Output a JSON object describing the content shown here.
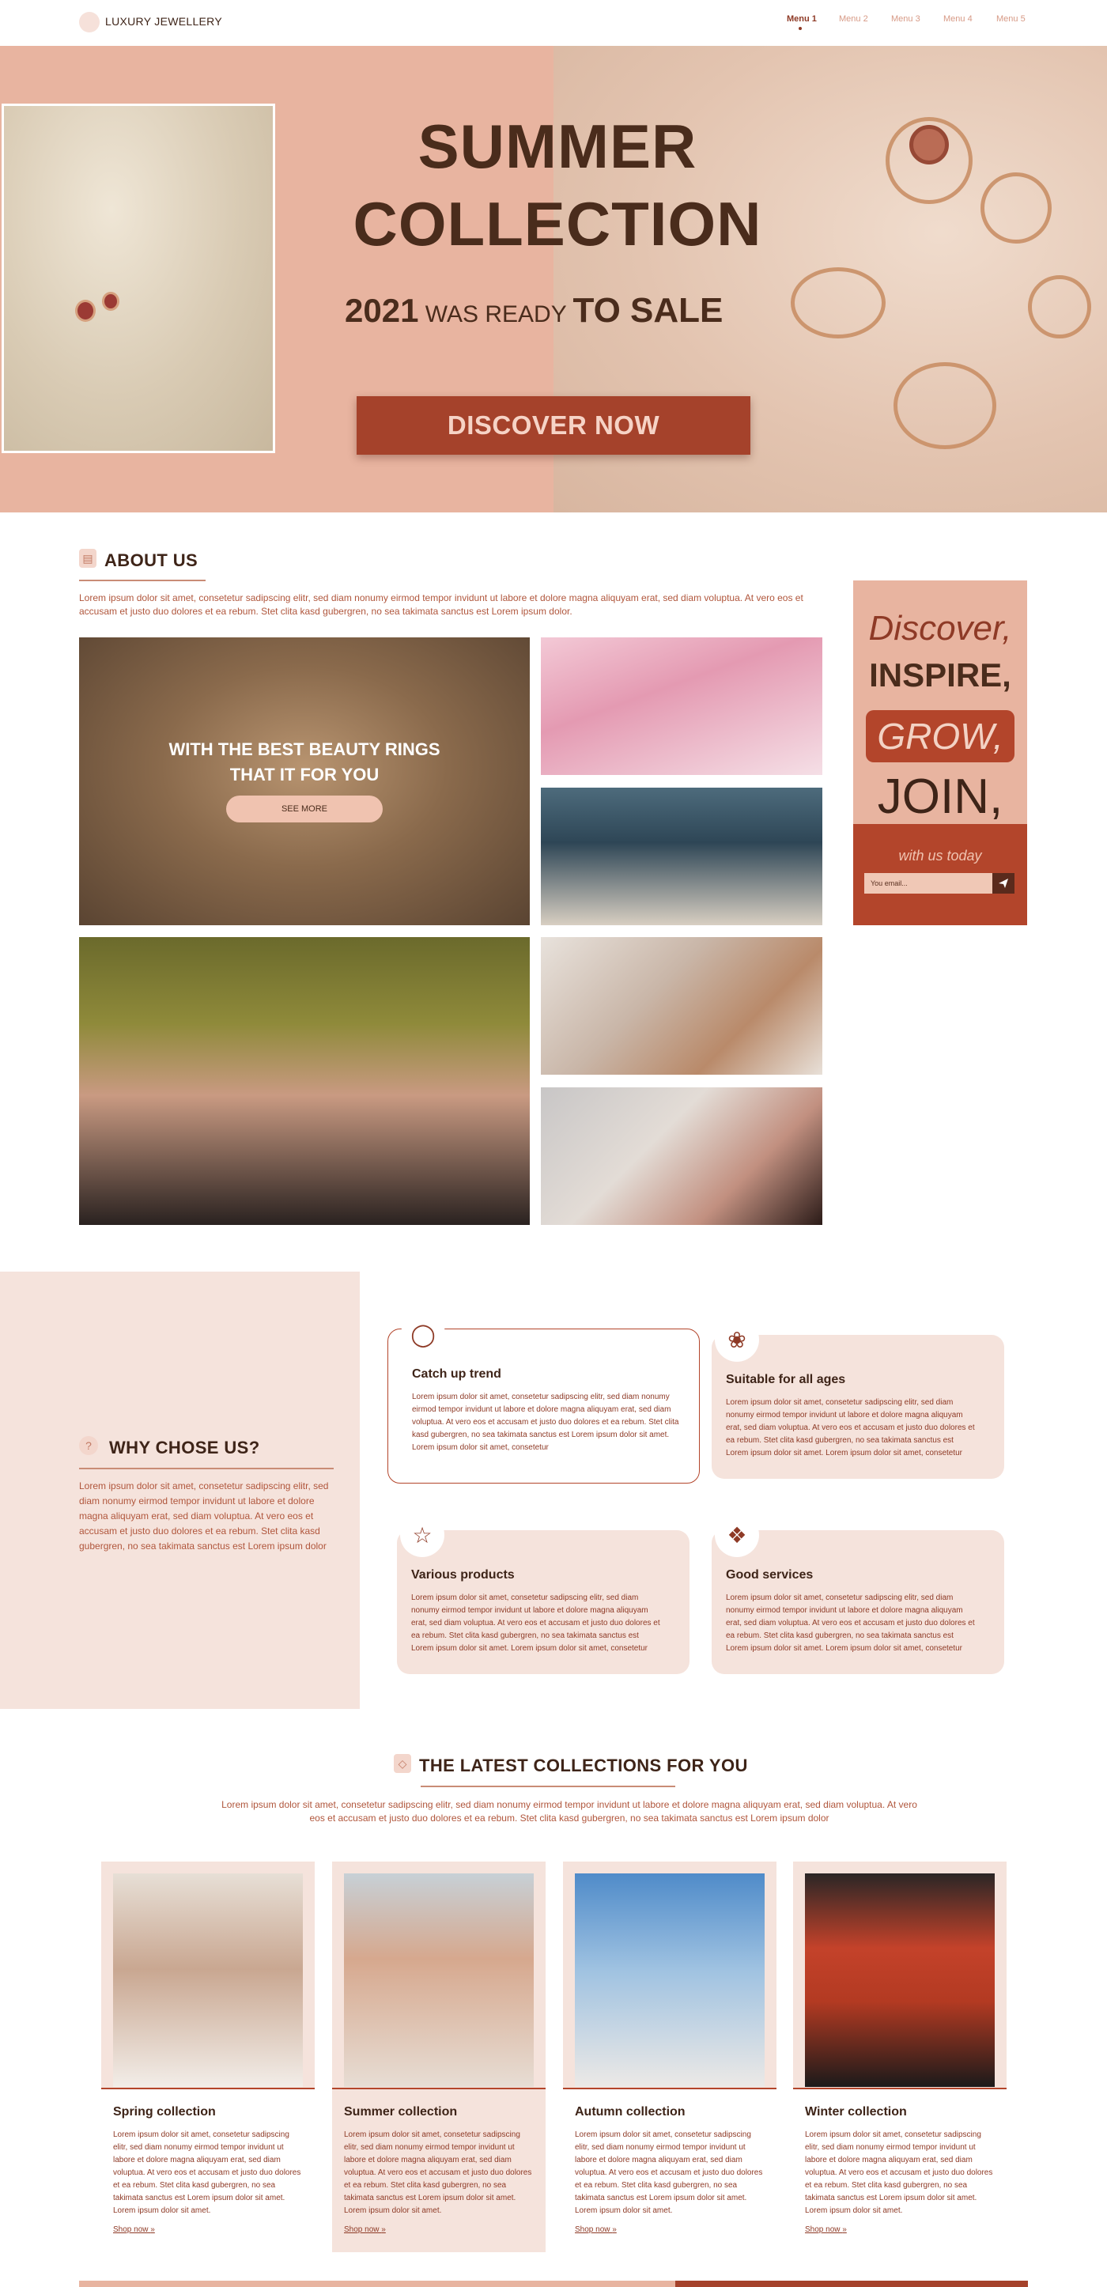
{
  "header": {
    "logo_text": "LUXURY JEWELLERY",
    "nav": [
      "Menu 1",
      "Menu 2",
      "Menu 3",
      "Menu 4",
      "Menu 5"
    ]
  },
  "hero": {
    "title_line1": "SUMMER",
    "title_line2": "COLLECTION",
    "year": "2021",
    "was_ready": "WAS READY",
    "to_sale": "TO SALE",
    "cta": "DISCOVER NOW"
  },
  "about": {
    "title": "ABOUT US",
    "text": "Lorem ipsum dolor sit amet, consetetur sadipscing elitr, sed diam nonumy eirmod tempor invidunt ut labore et dolore magna aliquyam erat, sed diam voluptua. At vero eos et accusam et justo duo dolores et ea rebum. Stet clita kasd gubergren, no sea takimata sanctus est Lorem ipsum dolor.",
    "feature_line1": "WITH THE BEST  BEAUTY RINGS",
    "feature_line2": "THAT IT FOR YOU",
    "see_more": "SEE MORE"
  },
  "banner": {
    "discover": "Discover,",
    "inspire": "INSPIRE,",
    "grow": "GROW,",
    "join": "JOIN,",
    "with_us": "with us today",
    "email_placeholder": "You email..."
  },
  "why": {
    "title": "WHY CHOSE US?",
    "text": "Lorem ipsum dolor sit amet, consetetur sadipscing elitr, sed diam nonumy eirmod tempor invidunt ut labore et dolore magna aliquyam erat, sed diam voluptua. At vero eos et accusam et justo duo dolores et ea rebum. Stet clita kasd gubergren, no sea takimata sanctus est Lorem ipsum dolor",
    "cards": [
      {
        "title": "Catch up trend",
        "text": "Lorem ipsum dolor sit amet, consetetur sadipscing elitr, sed diam nonumy eirmod tempor invidunt ut labore et dolore magna aliquyam erat, sed diam voluptua. At vero eos et accusam et justo duo dolores et ea rebum. Stet clita kasd gubergren, no sea takimata sanctus est Lorem ipsum dolor sit amet. Lorem ipsum dolor sit amet, consetetur"
      },
      {
        "title": "Suitable for all ages",
        "text": "Lorem ipsum dolor sit amet, consetetur sadipscing elitr, sed diam nonumy eirmod tempor invidunt ut labore et dolore magna aliquyam erat, sed diam voluptua. At vero eos et accusam et justo duo dolores et ea rebum. Stet clita kasd gubergren, no sea takimata sanctus est Lorem ipsum dolor sit amet. Lorem ipsum dolor sit amet, consetetur"
      },
      {
        "title": "Various products",
        "text": "Lorem ipsum dolor sit amet, consetetur sadipscing elitr, sed diam nonumy eirmod tempor invidunt ut labore et dolore magna aliquyam erat, sed diam voluptua. At vero eos et accusam et justo duo dolores et ea rebum. Stet clita kasd gubergren, no sea takimata sanctus est Lorem ipsum dolor sit amet. Lorem ipsum dolor sit amet, consetetur"
      },
      {
        "title": "Good services",
        "text": "Lorem ipsum dolor sit amet, consetetur sadipscing elitr, sed diam nonumy eirmod tempor invidunt ut labore et dolore magna aliquyam erat, sed diam voluptua. At vero eos et accusam et justo duo dolores et ea rebum. Stet clita kasd gubergren, no sea takimata sanctus est Lorem ipsum dolor sit amet. Lorem ipsum dolor sit amet, consetetur"
      }
    ]
  },
  "collections": {
    "title": "THE LATEST COLLECTIONS FOR YOU",
    "text": "Lorem ipsum dolor sit amet, consetetur sadipscing elitr, sed diam nonumy eirmod tempor invidunt ut labore et dolore magna aliquyam erat, sed diam voluptua. At vero eos et accusam et justo duo dolores et ea rebum. Stet clita kasd gubergren, no sea takimata sanctus est Lorem ipsum dolor",
    "items": [
      {
        "title": "Spring collection",
        "text": "Lorem ipsum dolor sit amet, consetetur sadipscing elitr, sed diam nonumy eirmod tempor invidunt ut labore et dolore magna aliquyam erat, sed diam voluptua. At vero eos et accusam et justo duo dolores et ea rebum. Stet clita kasd gubergren, no sea takimata sanctus est Lorem ipsum dolor sit amet. Lorem ipsum dolor sit amet.",
        "link": "Shop now"
      },
      {
        "title": "Summer collection",
        "text": "Lorem ipsum dolor sit amet, consetetur sadipscing elitr, sed diam nonumy eirmod tempor invidunt ut labore et dolore magna aliquyam erat, sed diam voluptua. At vero eos et accusam et justo duo dolores et ea rebum. Stet clita kasd gubergren, no sea takimata sanctus est Lorem ipsum dolor sit amet. Lorem ipsum dolor sit amet.",
        "link": "Shop now"
      },
      {
        "title": "Autumn collection",
        "text": "Lorem ipsum dolor sit amet, consetetur sadipscing elitr, sed diam nonumy eirmod tempor invidunt ut labore et dolore magna aliquyam erat, sed diam voluptua. At vero eos et accusam et justo duo dolores et ea rebum. Stet clita kasd gubergren, no sea takimata sanctus est Lorem ipsum dolor sit amet. Lorem ipsum dolor sit amet.",
        "link": "Shop now"
      },
      {
        "title": "Winter collection",
        "text": "Lorem ipsum dolor sit amet, consetetur sadipscing elitr, sed diam nonumy eirmod tempor invidunt ut labore et dolore magna aliquyam erat, sed diam voluptua. At vero eos et accusam et justo duo dolores et ea rebum. Stet clita kasd gubergren, no sea takimata sanctus est Lorem ipsum dolor sit amet. Lorem ipsum dolor sit amet.",
        "link": "Shop now"
      }
    ]
  },
  "colors": {
    "brand_dark": "#3e2418",
    "accent": "#a5422b",
    "blush": "#e8b4a0",
    "light_blush": "#f5e3dc"
  },
  "icons": {
    "logo": "logo-dot-icon",
    "about": "document-icon",
    "why": "question-icon",
    "collections": "ring-icon",
    "send": "send-arrow-icon",
    "shop_link": "double-chevron-right-icon"
  }
}
